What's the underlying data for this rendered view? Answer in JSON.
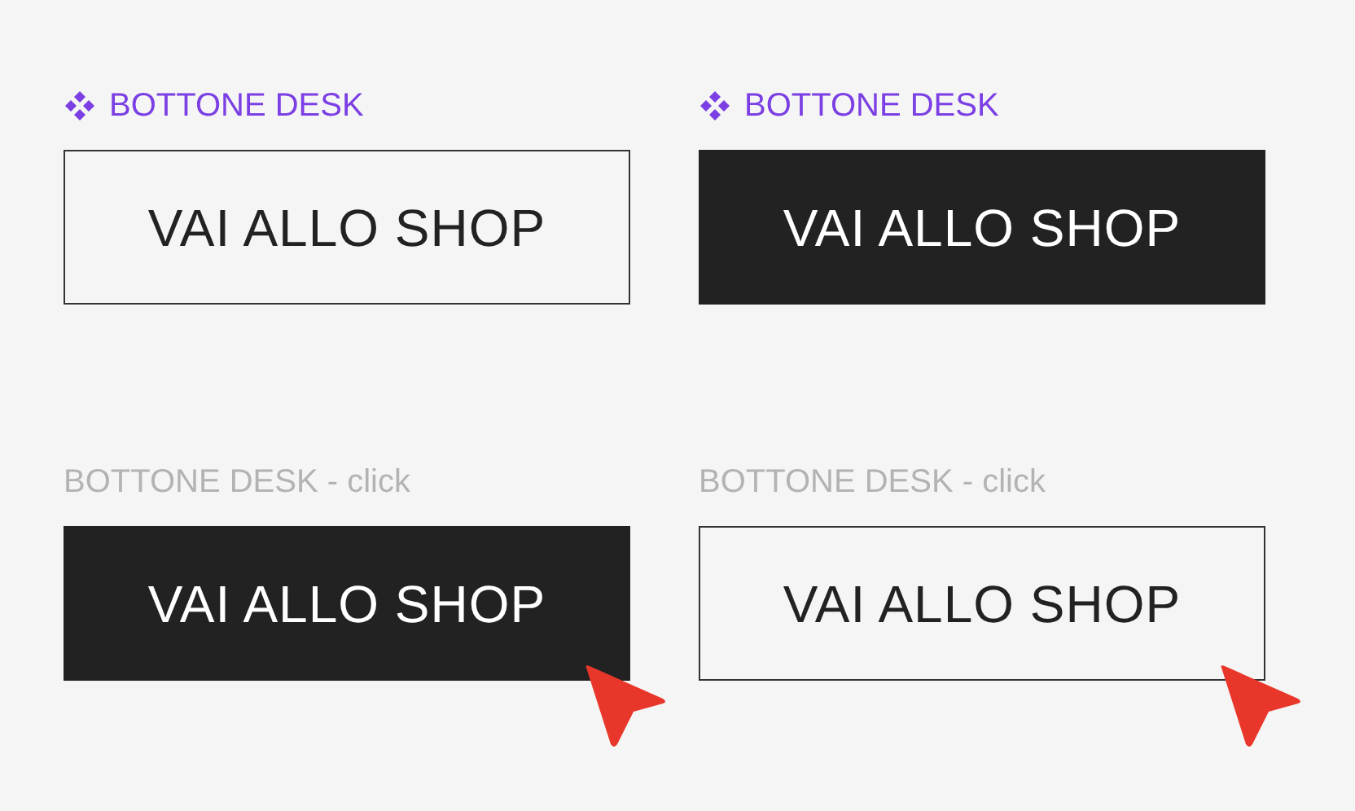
{
  "variants": [
    {
      "label": {
        "text": "BOTTONE DESK",
        "kind": "component"
      },
      "button": {
        "text": "VAI ALLO SHOP",
        "kind": "outline"
      },
      "cursor": false
    },
    {
      "label": {
        "text": "BOTTONE DESK",
        "kind": "component"
      },
      "button": {
        "text": "VAI ALLO SHOP",
        "kind": "filled"
      },
      "cursor": false
    },
    {
      "label": {
        "text": "BOTTONE DESK - click",
        "kind": "plain"
      },
      "button": {
        "text": "VAI ALLO SHOP",
        "kind": "filled"
      },
      "cursor": true
    },
    {
      "label": {
        "text": "BOTTONE DESK - click",
        "kind": "plain"
      },
      "button": {
        "text": "VAI ALLO SHOP",
        "kind": "outline"
      },
      "cursor": true
    }
  ]
}
